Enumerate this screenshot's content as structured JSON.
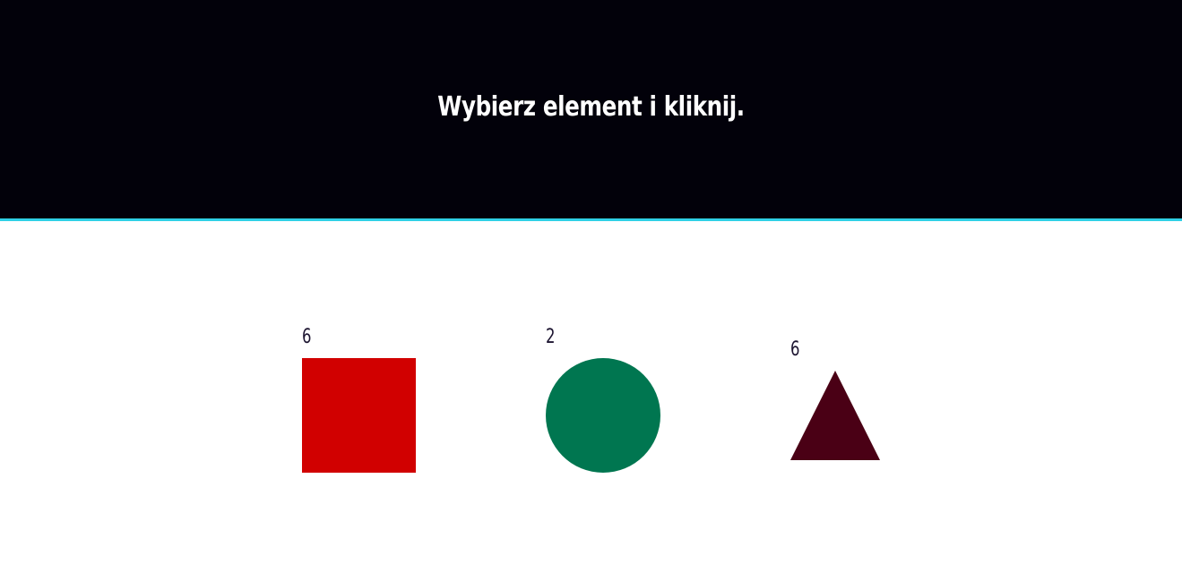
{
  "header": {
    "title": "Wybierz element i kliknij."
  },
  "items": [
    {
      "shape": "square",
      "number": "6",
      "color": "#d10000"
    },
    {
      "shape": "circle",
      "number": "2",
      "color": "#007650"
    },
    {
      "shape": "triangle",
      "number": "6",
      "color": "#4a0015"
    }
  ],
  "colors": {
    "header_background": "#02010a",
    "header_border": "#2fd0e6",
    "page_background": "#ffffff",
    "label_text": "#1c1430"
  }
}
